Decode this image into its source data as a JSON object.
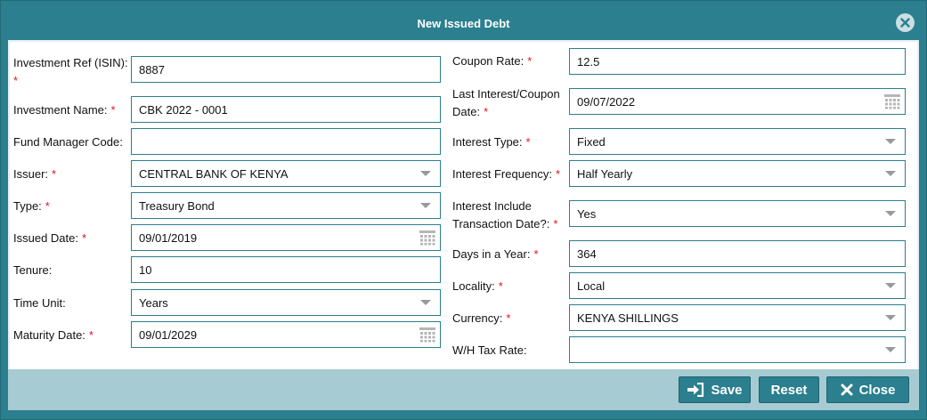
{
  "dialog": {
    "title": "New Issued Debt",
    "close_icon": "close-circle-icon"
  },
  "required_mark": "*",
  "left_fields": [
    {
      "label": "Investment Ref (ISIN):",
      "required": true,
      "value": "8887",
      "kind": "text"
    },
    {
      "label": "Investment Name:",
      "required": true,
      "value": "CBK 2022 - 0001",
      "kind": "text"
    },
    {
      "label": "Fund Manager Code:",
      "required": false,
      "value": "",
      "kind": "text"
    },
    {
      "label": "Issuer:",
      "required": true,
      "value": "CENTRAL BANK OF KENYA",
      "kind": "select"
    },
    {
      "label": "Type:",
      "required": true,
      "value": "Treasury Bond",
      "kind": "select"
    },
    {
      "label": "Issued Date:",
      "required": true,
      "value": "09/01/2019",
      "kind": "date"
    },
    {
      "label": "Tenure:",
      "required": false,
      "value": "10",
      "kind": "text"
    },
    {
      "label": "Time Unit:",
      "required": false,
      "value": "Years",
      "kind": "select"
    },
    {
      "label": "Maturity Date:",
      "required": true,
      "value": "09/01/2029",
      "kind": "date"
    }
  ],
  "right_fields": [
    {
      "label": "Coupon Rate:",
      "required": true,
      "value": "12.5",
      "kind": "text"
    },
    {
      "label": "Last Interest/Coupon Date:",
      "required": true,
      "value": "09/07/2022",
      "kind": "date"
    },
    {
      "label": "Interest Type:",
      "required": true,
      "value": "Fixed",
      "kind": "select"
    },
    {
      "label": "Interest Frequency:",
      "required": true,
      "value": "Half Yearly",
      "kind": "select"
    },
    {
      "label": "Interest Include Transaction Date?:",
      "required": true,
      "value": "Yes",
      "kind": "select"
    },
    {
      "label": "Days in a Year:",
      "required": true,
      "value": "364",
      "kind": "text"
    },
    {
      "label": "Locality:",
      "required": true,
      "value": "Local",
      "kind": "select"
    },
    {
      "label": "Currency:",
      "required": true,
      "value": "KENYA SHILLINGS",
      "kind": "select"
    },
    {
      "label": "W/H Tax Rate:",
      "required": false,
      "value": "",
      "kind": "select"
    }
  ],
  "footer": {
    "save_label": "Save",
    "reset_label": "Reset",
    "close_label": "Close"
  },
  "colors": {
    "header": "#2b7f8e",
    "footer": "#a7cbd2",
    "required": "#e0141e"
  }
}
